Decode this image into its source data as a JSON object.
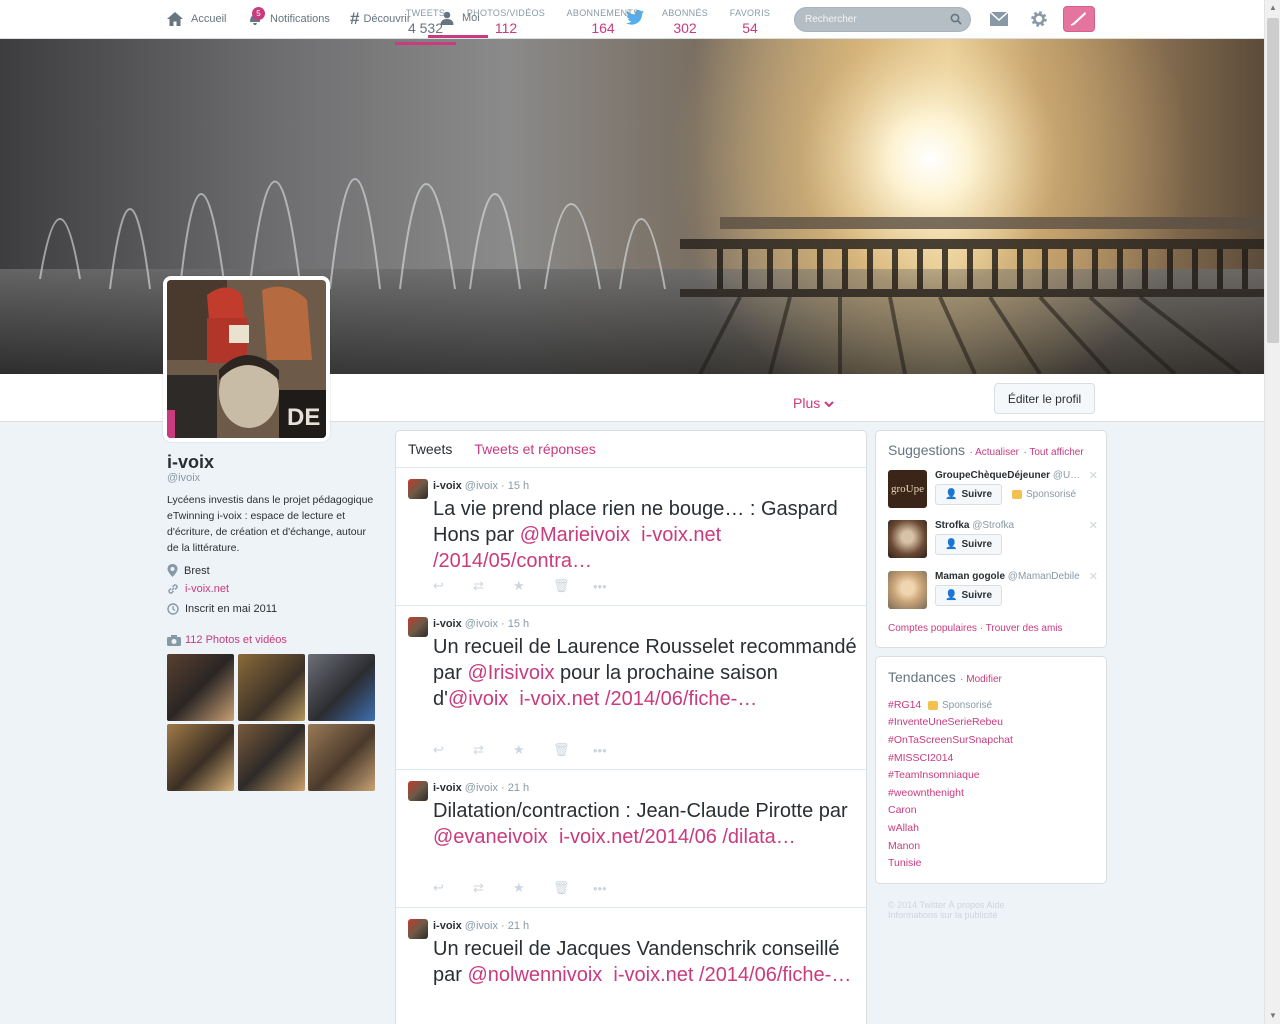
{
  "nav": {
    "home": "Accueil",
    "notifications": "Notifications",
    "notifications_count": "5",
    "discover": "Découvrir",
    "me": "Moi",
    "search_placeholder": "Rechercher"
  },
  "profile_stats": [
    {
      "label": "TWEETS",
      "value": "4 532"
    },
    {
      "label": "PHOTOS/VIDÉOS",
      "value": "112"
    },
    {
      "label": "ABONNEMENTS",
      "value": "164"
    },
    {
      "label": "ABONNÉS",
      "value": "302"
    },
    {
      "label": "FAVORIS",
      "value": "54"
    }
  ],
  "more_label": "Plus",
  "edit_profile": "Éditer le profil",
  "profile": {
    "name": "i-voix",
    "handle": "@ivoix",
    "bio": "Lycéens investis dans le projet pédagogique eTwinning i-voix : espace de lecture et d'écriture, de création et d'échange, autour de la littérature.",
    "location": "Brest",
    "website": "i-voix.net",
    "joined": "Inscrit en mai 2011",
    "photos_link": "112 Photos et vidéos"
  },
  "timeline": {
    "tab_tweets": "Tweets",
    "tab_replies": "Tweets et réponses",
    "tweets": [
      {
        "author": "i-voix",
        "handle": "@ivoix",
        "time": "· 15 h",
        "text_a": "La vie prend place rien ne bouge… : Gaspard Hons par ",
        "mention": "@Marieivoix",
        "link": "i-voix.net /2014/05/contra…"
      },
      {
        "author": "i-voix",
        "handle": "@ivoix",
        "time": "· 15 h",
        "text_a": "Un recueil de Laurence Rousselet recommandé par ",
        "mention": "@Irisivoix",
        "text_b": " pour la prochaine saison d'",
        "mention2": "@ivoix",
        "link": "i-voix.net /2014/06/fiche-…"
      },
      {
        "author": "i-voix",
        "handle": "@ivoix",
        "time": "· 21 h",
        "text_a": "Dilatation/contraction : Jean-Claude Pirotte par ",
        "mention": "@evaneivoix",
        "link": "i-voix.net/2014/06 /dilata…"
      },
      {
        "author": "i-voix",
        "handle": "@ivoix",
        "time": "· 21 h",
        "text_a": "Un recueil de Jacques Vandenschrik conseillé par ",
        "mention": "@nolwennivoix",
        "link": "i-voix.net /2014/06/fiche-…"
      }
    ]
  },
  "suggestions": {
    "title": "Suggestions",
    "refresh": "· Actualiser",
    "view_all": "· Tout afficher",
    "follow_label": "Suivre",
    "sponsored": "Sponsorisé",
    "items": [
      {
        "name": "GroupeChèqueDéjeuner",
        "handle": "@U…"
      },
      {
        "name": "Strofka",
        "handle": "@Strofka"
      },
      {
        "name": "Maman gogole",
        "handle": "@MamanDebile"
      }
    ],
    "footer": "Comptes populaires · Trouver des amis"
  },
  "trends": {
    "title": "Tendances",
    "change": "· Modifier",
    "sponsored": "Sponsorisé",
    "items": [
      "#RG14",
      "#InventeUneSerieRebeu",
      "#OnTaScreenSurSnapchat",
      "#MISSCI2014",
      "#TeamInsomniaque",
      "#weownthenight",
      "Caron",
      "wAllah",
      "Manon",
      "Tunisie"
    ]
  },
  "footer": {
    "line1": "© 2014 Twitter   À propos   Aide",
    "line2": "Informations sur la publicité"
  },
  "colors": {
    "accent": "#c93a7e",
    "background": "#eef3f7"
  }
}
